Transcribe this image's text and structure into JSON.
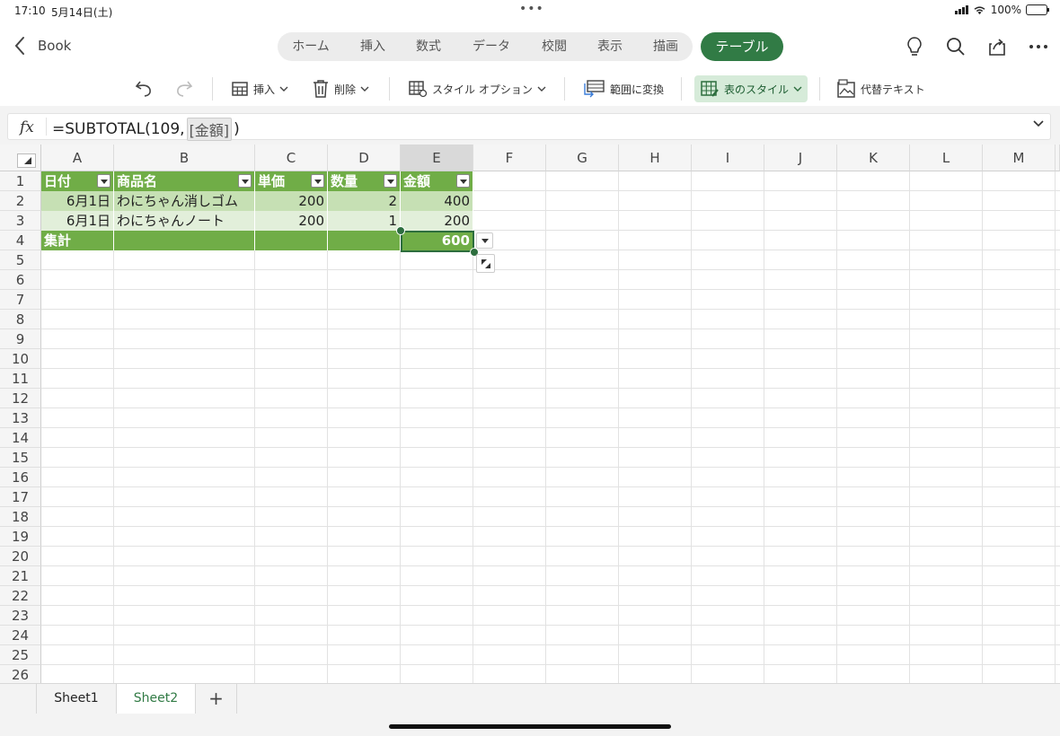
{
  "status": {
    "time": "17:10",
    "date": "5月14日(土)",
    "battery": "100%",
    "dots": "•••"
  },
  "nav": {
    "back_label": "Book",
    "tabs": [
      "ホーム",
      "挿入",
      "数式",
      "データ",
      "校閲",
      "表示",
      "描画"
    ],
    "active_tab": "テーブル"
  },
  "ribbon": {
    "insert": "挿入",
    "delete": "削除",
    "style_options": "スタイル オプション",
    "convert_to_range": "範囲に変換",
    "table_styles": "表のスタイル",
    "alt_text": "代替テキスト"
  },
  "formula": {
    "prefix": "=SUBTOTAL(109,",
    "ref": "[金額]",
    "suffix": ")",
    "fx": "fx"
  },
  "grid": {
    "columns": [
      "A",
      "B",
      "C",
      "D",
      "E",
      "F",
      "G",
      "H",
      "I",
      "J",
      "K",
      "L",
      "M"
    ],
    "selected_column": "E",
    "rows": [
      "1",
      "2",
      "3",
      "4",
      "5",
      "6",
      "7",
      "8",
      "9",
      "10",
      "11",
      "12",
      "13",
      "14",
      "15",
      "16",
      "17",
      "18",
      "19",
      "20",
      "21",
      "22",
      "23",
      "24",
      "25",
      "26"
    ],
    "table": {
      "headers": [
        "日付",
        "商品名",
        "単価",
        "数量",
        "金額"
      ],
      "data": [
        [
          "6月1日",
          "わにちゃん消しゴム",
          "200",
          "2",
          "400"
        ],
        [
          "6月1日",
          "わにちゃんノート",
          "200",
          "1",
          "200"
        ]
      ],
      "total_label": "集計",
      "total_value": "600"
    },
    "accent_color": "#70ad47"
  },
  "sheets": {
    "tabs": [
      "Sheet1",
      "Sheet2"
    ],
    "active": "Sheet2",
    "add": "+"
  }
}
